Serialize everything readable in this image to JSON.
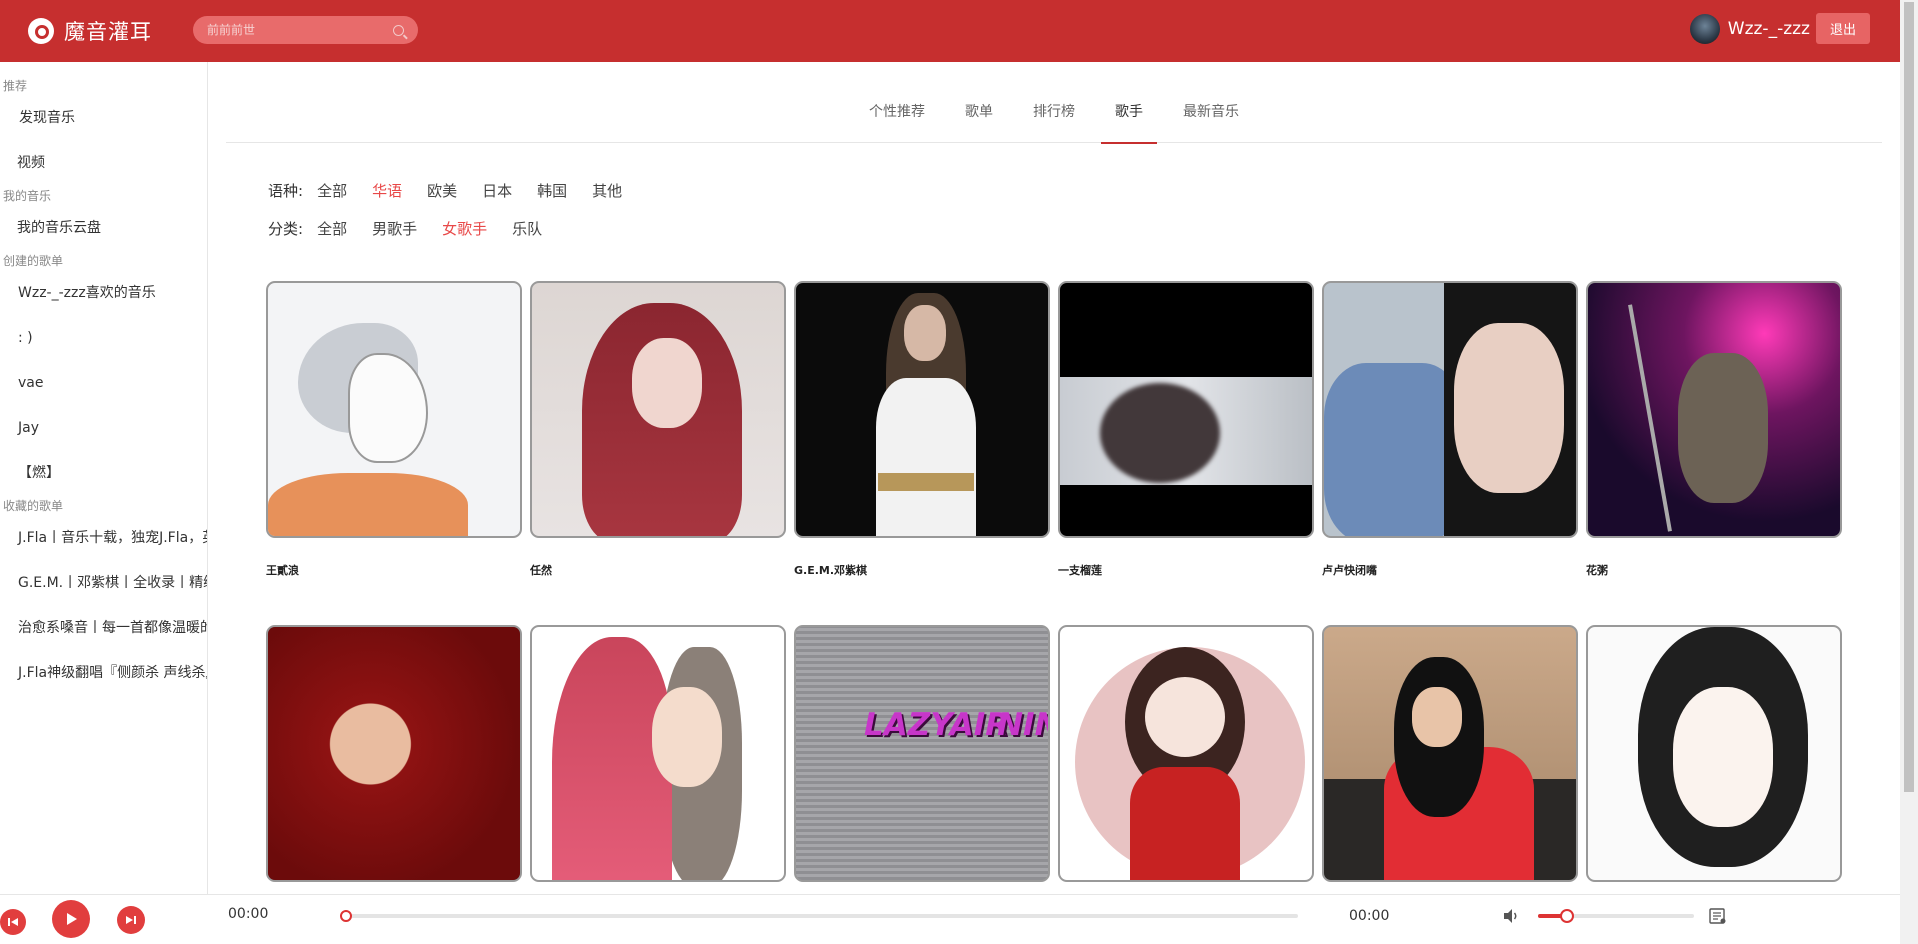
{
  "header": {
    "app_name": "魔音灌耳",
    "search_placeholder": "前前前世",
    "username": "Wzz-_-zzz",
    "logout_label": "退出"
  },
  "sidebar": {
    "groups": [
      {
        "title": "推荐",
        "items": [
          "发现音乐",
          "视频"
        ]
      },
      {
        "title": "我的音乐",
        "items": [
          "我的音乐云盘"
        ]
      },
      {
        "title": "创建的歌单",
        "items": [
          "Wzz-_-zzz喜欢的音乐",
          ": )",
          "vae",
          "Jay",
          "【燃】"
        ]
      },
      {
        "title": "收藏的歌单",
        "items": [
          "J.Fla丨音乐十载，独宠J.Fla，英",
          "G.E.M.丨邓紫棋丨全收录丨精编",
          "治愈系嗓音丨每一首都像温暖的",
          "J.Fla神级翻唱『侧颜杀 声线杀』"
        ]
      }
    ]
  },
  "tabs": [
    "个性推荐",
    "歌单",
    "排行榜",
    "歌手",
    "最新音乐"
  ],
  "active_tab": "歌手",
  "filters": {
    "language": {
      "label": "语种:",
      "options": [
        "全部",
        "华语",
        "欧美",
        "日本",
        "韩国",
        "其他"
      ],
      "selected": "华语"
    },
    "category": {
      "label": "分类:",
      "options": [
        "全部",
        "男歌手",
        "女歌手",
        "乐队"
      ],
      "selected": "女歌手"
    }
  },
  "artists": [
    {
      "name": "王貳浪"
    },
    {
      "name": "任然"
    },
    {
      "name": "G.E.M.邓紫棋"
    },
    {
      "name": "一支榴莲"
    },
    {
      "name": "卢卢快闭嘴"
    },
    {
      "name": "花粥"
    },
    {
      "name": ""
    },
    {
      "name": ""
    },
    {
      "name": "",
      "cover_text": [
        "LAZYAIR",
        "NINEONE"
      ]
    },
    {
      "name": ""
    },
    {
      "name": ""
    },
    {
      "name": ""
    }
  ],
  "player": {
    "current_time": "00:00",
    "total_time": "00:00",
    "progress": 0,
    "volume": 0.15,
    "accent_color": "#c62f2f"
  }
}
